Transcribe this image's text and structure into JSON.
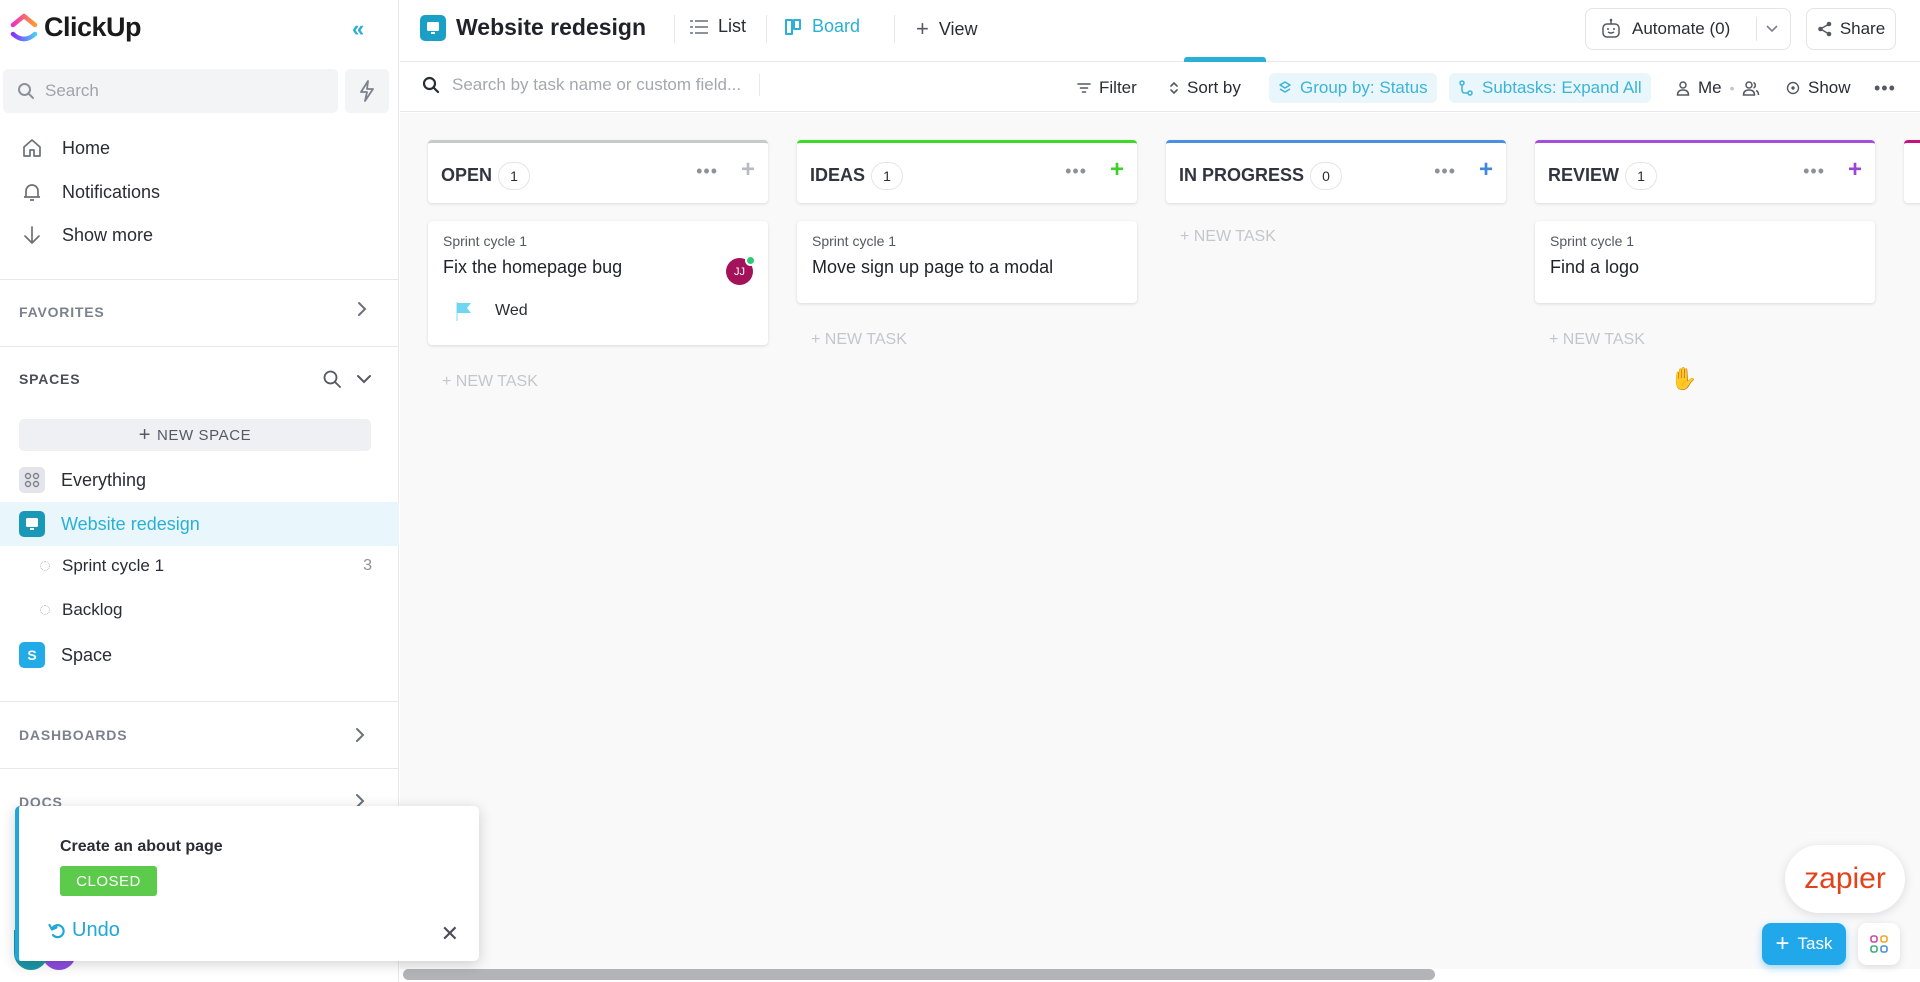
{
  "app": {
    "name": "ClickUp"
  },
  "sidebar": {
    "search_placeholder": "Search",
    "nav": [
      {
        "label": "Home",
        "icon": "home-icon"
      },
      {
        "label": "Notifications",
        "icon": "bell-icon"
      },
      {
        "label": "Show more",
        "icon": "arrow-down-icon"
      }
    ],
    "favorites_label": "FAVORITES",
    "spaces_label": "SPACES",
    "new_space_label": "NEW SPACE",
    "spaces": [
      {
        "label": "Everything",
        "icon": "grid-icon"
      },
      {
        "label": "Website redesign",
        "icon": "monitor-icon",
        "active": true
      },
      {
        "label": "Space",
        "icon_letter": "S"
      }
    ],
    "lists": [
      {
        "label": "Sprint cycle 1",
        "count": "3"
      },
      {
        "label": "Backlog",
        "count": ""
      }
    ],
    "dashboards_label": "DASHBOARDS",
    "docs_label": "DOCS"
  },
  "header": {
    "title": "Website redesign",
    "tabs": [
      {
        "label": "List",
        "active": false
      },
      {
        "label": "Board",
        "active": true
      }
    ],
    "add_view_label": "View",
    "automate_label": "Automate (0)",
    "share_label": "Share"
  },
  "toolbar": {
    "search_placeholder": "Search by task name or custom field...",
    "filter_label": "Filter",
    "sort_label": "Sort by",
    "group_label": "Group by: Status",
    "subtasks_label": "Subtasks: Expand All",
    "me_label": "Me",
    "show_label": "Show"
  },
  "board": {
    "new_task_label": "+ NEW TASK",
    "columns": [
      {
        "name": "OPEN",
        "count": "1",
        "color": "#c8c9cc",
        "plus_color": "#b8bbc0",
        "tasks": [
          {
            "list": "Sprint cycle 1",
            "title": "Fix the homepage bug",
            "assignee": "JJ",
            "due": "Wed",
            "priority_flag_color": "#6fd6f2"
          }
        ]
      },
      {
        "name": "IDEAS",
        "count": "1",
        "color": "#3fd92a",
        "plus_color": "#3fcf2a",
        "tasks": [
          {
            "list": "Sprint cycle 1",
            "title": "Move sign up page to a modal"
          }
        ]
      },
      {
        "name": "IN PROGRESS",
        "count": "0",
        "color": "#4a8fe0",
        "plus_color": "#3f86dc",
        "tasks": []
      },
      {
        "name": "REVIEW",
        "count": "1",
        "color": "#a44fd9",
        "plus_color": "#9a45d5",
        "tasks": [
          {
            "list": "Sprint cycle 1",
            "title": "Find a logo"
          }
        ]
      },
      {
        "name": "",
        "count": "",
        "color": "#c4127a",
        "plus_color": "#c4127a",
        "tasks": []
      }
    ]
  },
  "toast": {
    "title": "Create an about page",
    "status": "CLOSED",
    "status_color": "#5ccb4b",
    "undo_label": "Undo"
  },
  "fabs": {
    "zapier_label": "zapier",
    "task_label": "Task"
  }
}
